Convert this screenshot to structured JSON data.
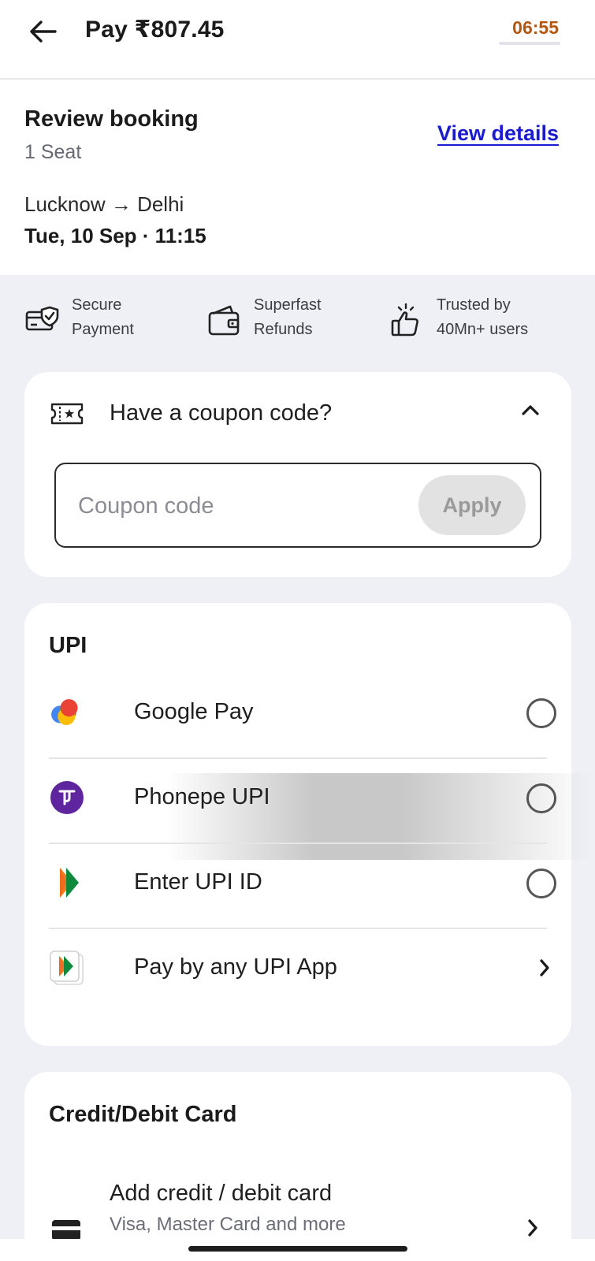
{
  "header": {
    "title": "Pay ₹807.45",
    "timer": "06:55"
  },
  "review": {
    "title": "Review booking",
    "seats": "1 Seat",
    "view_details": "View details",
    "route": "Lucknow → Delhi",
    "datetime": "Tue, 10 Sep · 11:15"
  },
  "features": [
    {
      "line1": "Secure",
      "line2": "Payment",
      "icon": "secure-card-icon"
    },
    {
      "line1": "Superfast",
      "line2": "Refunds",
      "icon": "wallet-icon"
    },
    {
      "line1": "Trusted by",
      "line2": "40Mn+ users",
      "icon": "thumbs-up-icon"
    }
  ],
  "coupon": {
    "title": "Have a coupon code?",
    "placeholder": "Coupon code",
    "value": "",
    "apply": "Apply"
  },
  "upi": {
    "title": "UPI",
    "options": [
      {
        "label": "Google Pay",
        "icon": "google-pay-icon",
        "control": "radio"
      },
      {
        "label": "Phonepe UPI",
        "icon": "phonepe-icon",
        "control": "radio"
      },
      {
        "label": "Enter UPI ID",
        "icon": "bhim-upi-icon",
        "control": "radio"
      },
      {
        "label": "Pay by any UPI App",
        "icon": "upi-app-icon",
        "control": "chevron"
      }
    ]
  },
  "cards": {
    "title": "Credit/Debit Card",
    "add_title": "Add credit / debit card",
    "add_subtitle": "Visa, Master Card and more"
  },
  "colors": {
    "timer": "#b5560f",
    "link": "#1a1ad4",
    "page_bg": "#eef0f6",
    "phonepe": "#5f259f"
  }
}
